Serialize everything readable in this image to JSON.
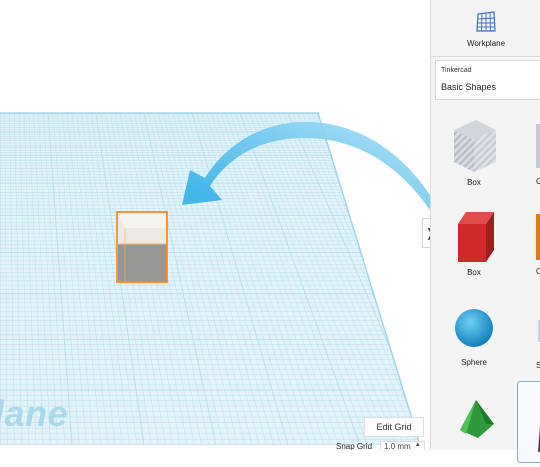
{
  "workplane_panel": {
    "label": "Workplane",
    "icon": "workplane-grid-icon"
  },
  "library": {
    "source": "Tinkercad",
    "category": "Basic Shapes"
  },
  "shapes": [
    {
      "name": "Box",
      "icon": "box-hole-icon",
      "color": "#b6bcc4"
    },
    {
      "name": "Box",
      "icon": "box-solid-icon",
      "color": "#d0292a"
    },
    {
      "name": "Sphere",
      "icon": "sphere-icon",
      "color": "#1c9ad7"
    },
    {
      "name": "",
      "icon": "roof-icon",
      "color": "#2f9a3a"
    }
  ],
  "canvas": {
    "workplane_text": "lane",
    "edit_grid_label": "Edit Grid",
    "snap_grid_label": "Snap Grid",
    "snap_grid_value": "1.0 mm"
  },
  "colors": {
    "grid": "#b8e2ef",
    "workplane": "#d7eef6",
    "selection": "#ff8a1e",
    "arrow": "#5fc3ea"
  }
}
